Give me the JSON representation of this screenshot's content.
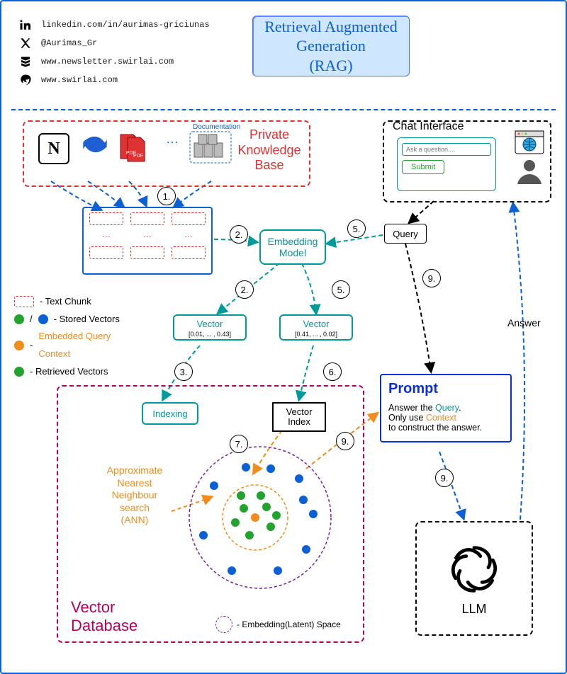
{
  "title_card": "Retrieval Augmented\nGeneration\n(RAG)",
  "socials": {
    "linkedin": "linkedin.com/in/aurimas-griciunas",
    "x": "@Aurimas_Gr",
    "newsletter": "www.newsletter.swirlai.com",
    "swirl": "www.swirlai.com"
  },
  "pkb": {
    "label": "Private\nKnowledge\nBase",
    "notion": "N",
    "pdf_tag": "PDF",
    "ellipsis": "…",
    "docs_label": "Documentation"
  },
  "chat": {
    "label": "Chat Interface",
    "placeholder": "Ask a question....",
    "submit": "Submit"
  },
  "embedding_model": "Embedding\nModel",
  "query_label": "Query",
  "vectors": {
    "left_label": "Vector",
    "left_values": "[0.01, ... , 0.43]",
    "right_label": "Vector",
    "right_values": "[0.41, ... , 0.02]"
  },
  "legend": {
    "chunk": "- Text Chunk",
    "stored": "- Stored Vectors",
    "embedded": "Embedded Query\nContext",
    "retrieved": "- Retrieved Vectors"
  },
  "vdb": {
    "label": "Vector\nDatabase",
    "indexing": "Indexing",
    "vector_index": "Vector\nIndex",
    "ann": "Approximate\nNearest\nNeighbour\nsearch\n(ANN)",
    "latent": "- Embedding(Latent) Space"
  },
  "prompt": {
    "heading": "Prompt",
    "l1a": "Answer the ",
    "l1b": "Query",
    "l2a": "Only use ",
    "l2b": "Context",
    "l3": "to construct the answer."
  },
  "answer": "Answer",
  "llm_label": "LLM",
  "steps": {
    "s1": "1.",
    "s2": "2.",
    "s2b": "2.",
    "s3": "3.",
    "s5": "5.",
    "s5b": "5.",
    "s6": "6.",
    "s7": "7.",
    "s9a": "9.",
    "s9b": "9.",
    "s9c": "9."
  }
}
